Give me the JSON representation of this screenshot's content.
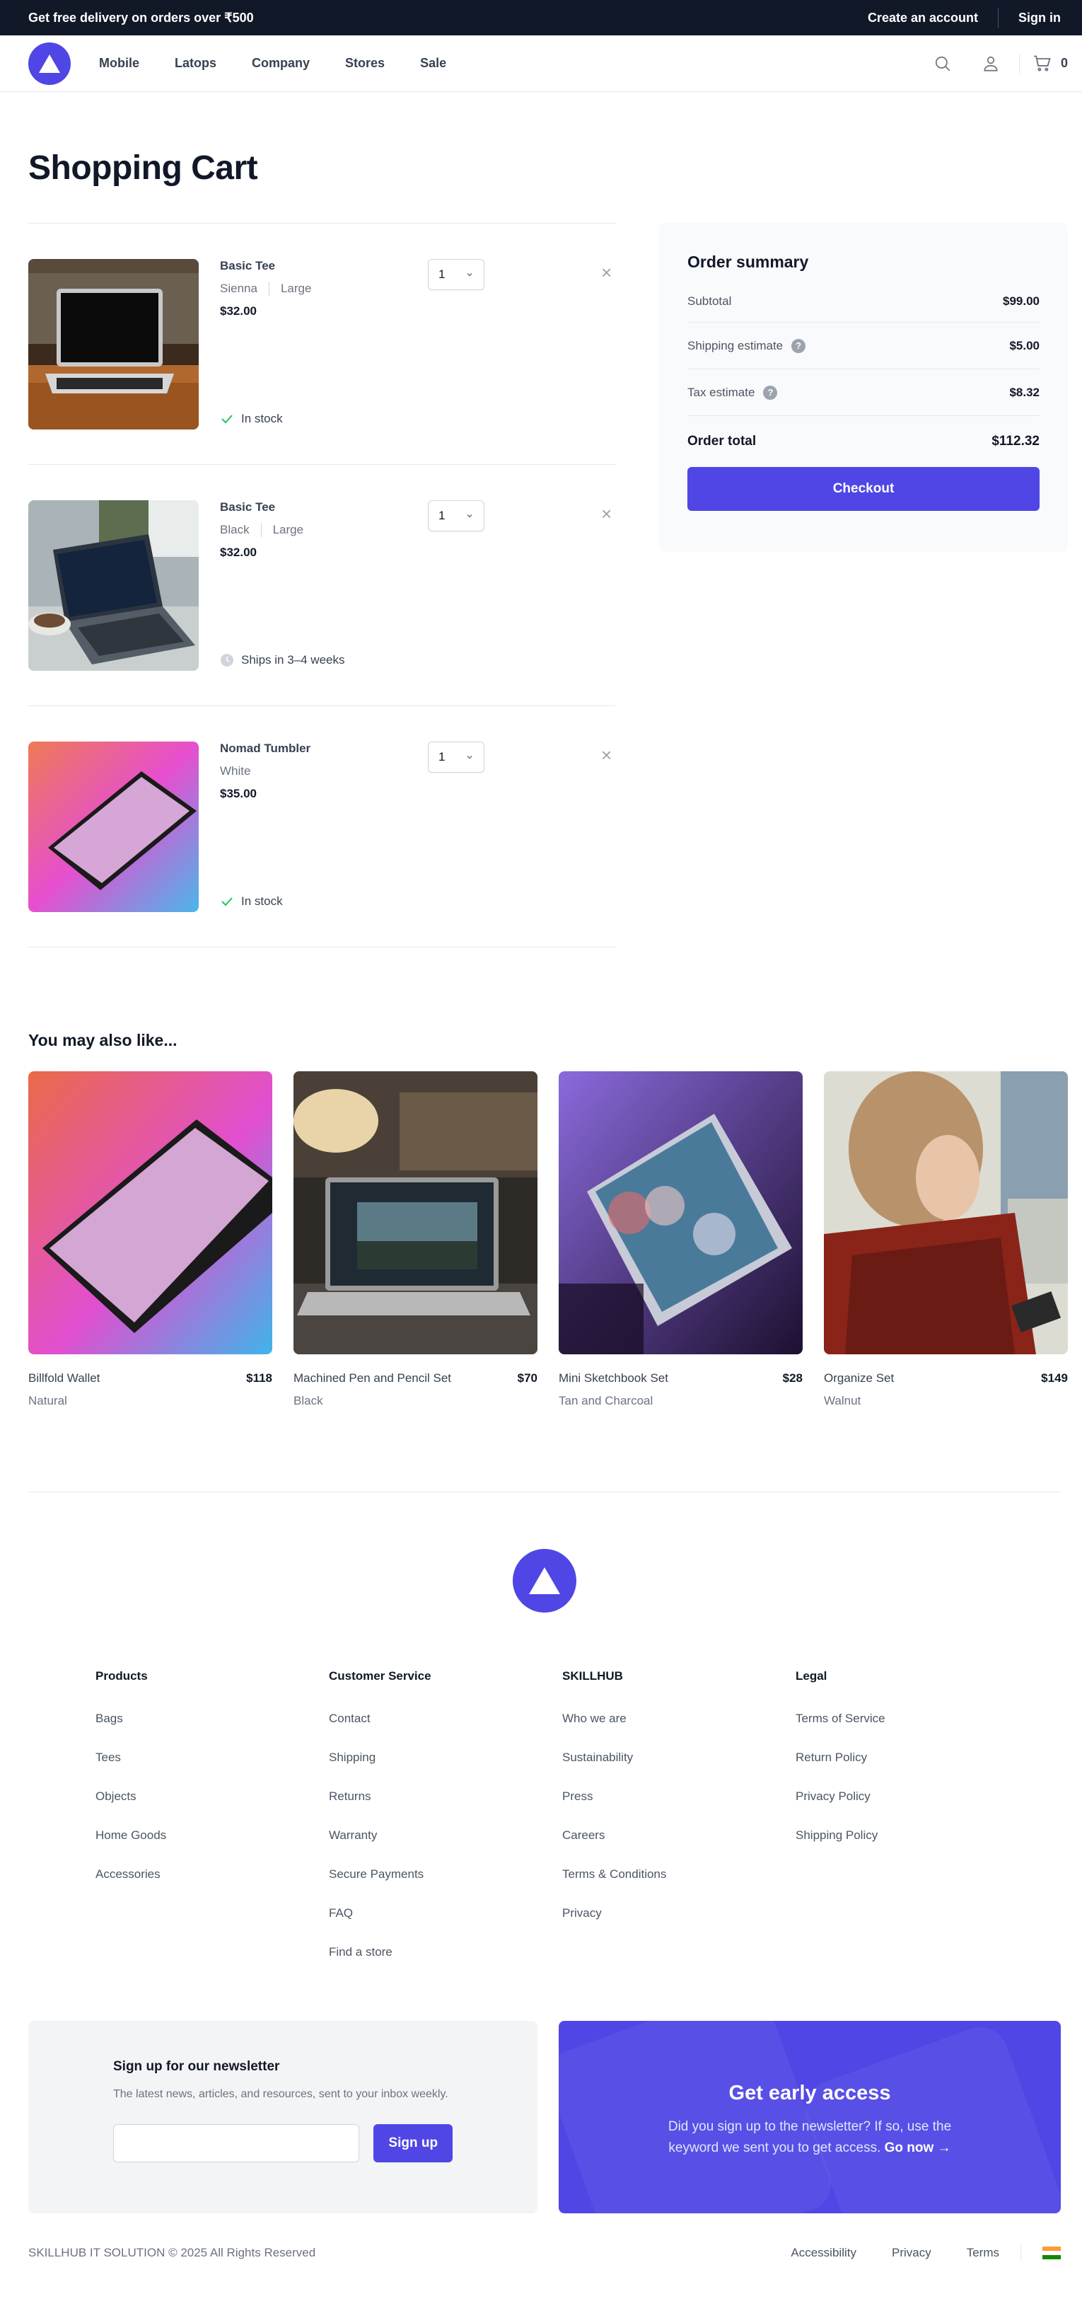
{
  "banner": {
    "text": "Get free delivery on orders over ₹500",
    "create_account": "Create an account",
    "sign_in": "Sign in"
  },
  "nav": {
    "links": [
      "Mobile",
      "Latops",
      "Company",
      "Stores",
      "Sale"
    ],
    "cart_count": "0"
  },
  "page_title": "Shopping Cart",
  "cart": {
    "items": [
      {
        "name": "Basic Tee",
        "color": "Sienna",
        "size": "Large",
        "price": "$32.00",
        "qty": "1",
        "status": "In stock",
        "status_icon": "check-icon"
      },
      {
        "name": "Basic Tee",
        "color": "Black",
        "size": "Large",
        "price": "$32.00",
        "qty": "1",
        "status": "Ships in 3–4 weeks",
        "status_icon": "clock-icon"
      },
      {
        "name": "Nomad Tumbler",
        "color": "White",
        "size": "",
        "price": "$35.00",
        "qty": "1",
        "status": "In stock",
        "status_icon": "check-icon"
      }
    ],
    "remove_symbol": "×"
  },
  "summary": {
    "title": "Order summary",
    "subtotal_label": "Subtotal",
    "subtotal": "$99.00",
    "shipping_label": "Shipping estimate",
    "shipping": "$5.00",
    "tax_label": "Tax estimate",
    "tax": "$8.32",
    "total_label": "Order total",
    "total": "$112.32",
    "help_symbol": "?",
    "checkout_label": "Checkout"
  },
  "recommendations": {
    "title": "You may also like...",
    "items": [
      {
        "name": "Billfold Wallet",
        "price": "$118",
        "variant": "Natural"
      },
      {
        "name": "Machined Pen and Pencil Set",
        "price": "$70",
        "variant": "Black"
      },
      {
        "name": "Mini Sketchbook Set",
        "price": "$28",
        "variant": "Tan and Charcoal"
      },
      {
        "name": "Organize Set",
        "price": "$149",
        "variant": "Walnut"
      }
    ]
  },
  "footer": {
    "columns": [
      {
        "title": "Products",
        "links": [
          "Bags",
          "Tees",
          "Objects",
          "Home Goods",
          "Accessories"
        ]
      },
      {
        "title": "Customer Service",
        "links": [
          "Contact",
          "Shipping",
          "Returns",
          "Warranty",
          "Secure Payments",
          "FAQ",
          "Find a store"
        ]
      },
      {
        "title": "SKILLHUB",
        "links": [
          "Who we are",
          "Sustainability",
          "Press",
          "Careers",
          "Terms & Conditions",
          "Privacy"
        ]
      },
      {
        "title": "Legal",
        "links": [
          "Terms of Service",
          "Return Policy",
          "Privacy Policy",
          "Shipping Policy"
        ]
      }
    ],
    "newsletter": {
      "title": "Sign up for our newsletter",
      "description": "The latest news, articles, and resources, sent to your inbox weekly.",
      "button": "Sign up"
    },
    "early_access": {
      "title": "Get early access",
      "text": "Did you sign up to the newsletter? If so, use the keyword we sent you to get access.",
      "link": "Go now →"
    },
    "copyright": "SKILLHUB IT SOLUTION © 2025 All Rights Reserved",
    "bottom_links": [
      "Accessibility",
      "Privacy",
      "Terms"
    ]
  },
  "colors": {
    "accent": "#4f46e5",
    "banner_bg": "#111827",
    "in_stock": "#22c55e"
  }
}
